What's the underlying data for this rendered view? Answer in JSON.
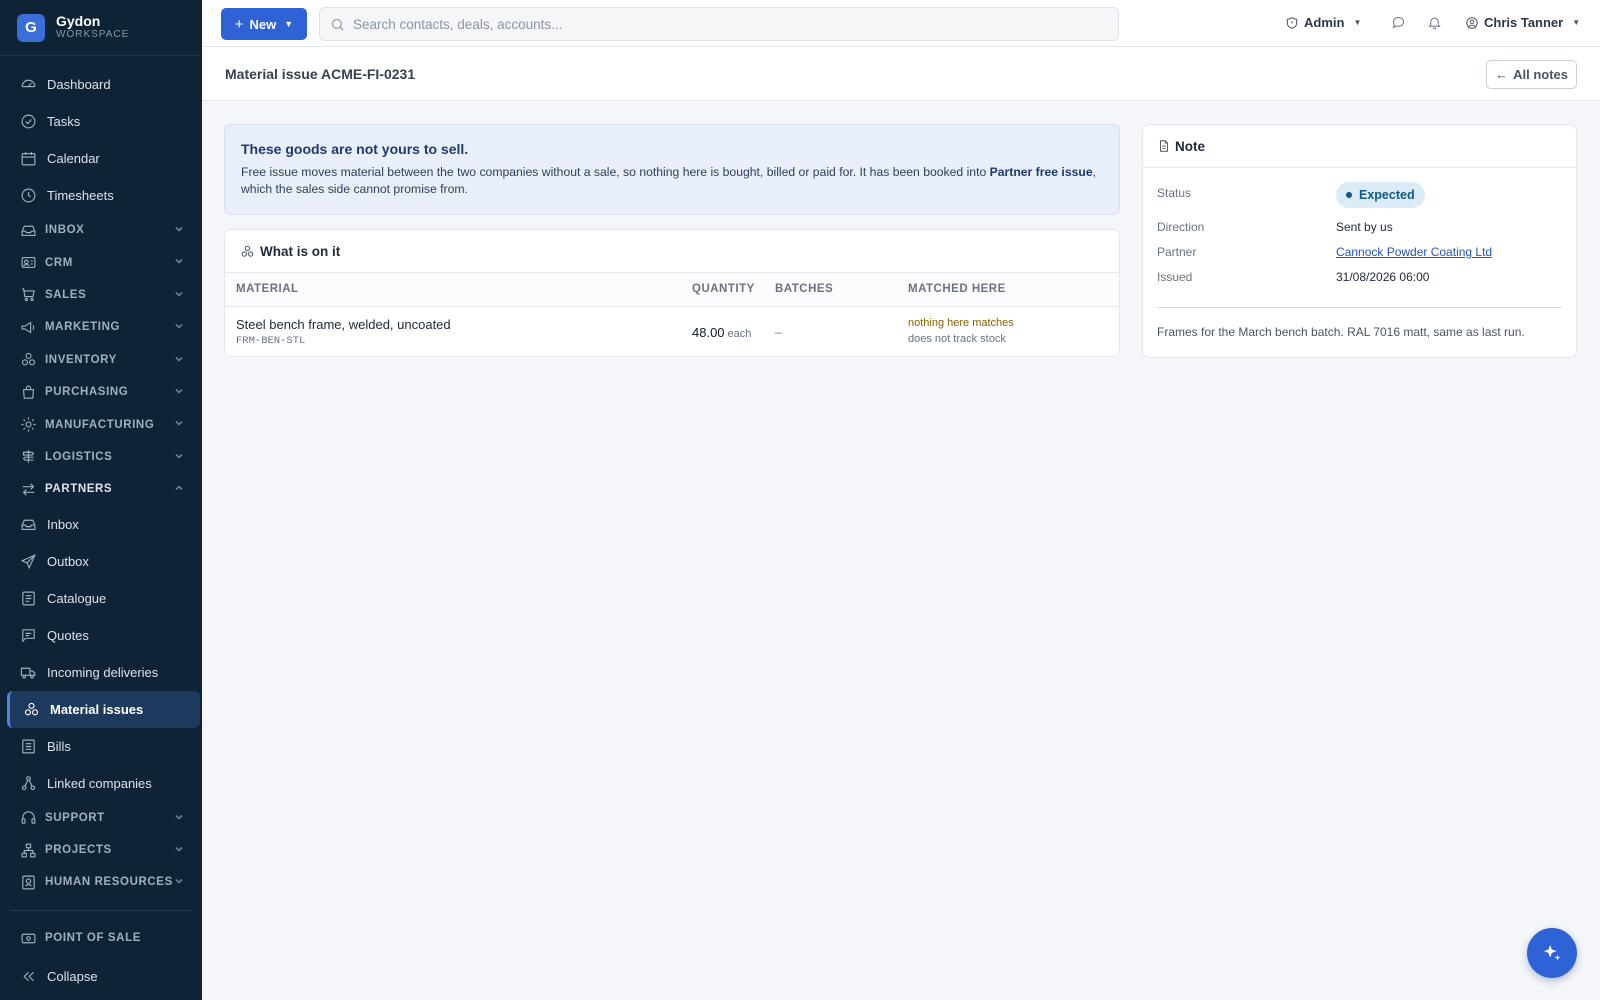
{
  "brand": {
    "name": "Gydon",
    "sub": "WORKSPACE",
    "logo_letter": "G"
  },
  "sidebar": {
    "items": [
      {
        "label": "Dashboard",
        "icon": "dashboard-icon"
      },
      {
        "label": "Tasks",
        "icon": "check-circle-icon"
      },
      {
        "label": "Calendar",
        "icon": "calendar-icon"
      },
      {
        "label": "Timesheets",
        "icon": "clock-icon"
      }
    ],
    "sections": [
      {
        "label": "INBOX",
        "icon": "inbox-icon"
      },
      {
        "label": "CRM",
        "icon": "contact-card-icon"
      },
      {
        "label": "SALES",
        "icon": "cart-icon"
      },
      {
        "label": "MARKETING",
        "icon": "megaphone-icon"
      },
      {
        "label": "INVENTORY",
        "icon": "boxes-icon"
      },
      {
        "label": "PURCHASING",
        "icon": "bag-icon"
      },
      {
        "label": "MANUFACTURING",
        "icon": "gear-icon"
      },
      {
        "label": "LOGISTICS",
        "icon": "signpost-icon"
      }
    ],
    "partners": {
      "label": "PARTNERS",
      "items": [
        {
          "label": "Inbox"
        },
        {
          "label": "Outbox"
        },
        {
          "label": "Catalogue"
        },
        {
          "label": "Quotes"
        },
        {
          "label": "Incoming deliveries"
        },
        {
          "label": "Material issues"
        },
        {
          "label": "Bills"
        },
        {
          "label": "Linked companies"
        }
      ]
    },
    "sections_after": [
      {
        "label": "SUPPORT"
      },
      {
        "label": "PROJECTS"
      },
      {
        "label": "HUMAN RESOURCES"
      }
    ],
    "pos": "POINT OF SALE",
    "collapse": "Collapse"
  },
  "topbar": {
    "new_label": "New",
    "search_placeholder": "Search contacts, deals, accounts...",
    "role": "Admin",
    "user": "Chris Tanner"
  },
  "page": {
    "title": "Material issue ACME-FI-0231",
    "all_notes": "All notes"
  },
  "alert": {
    "title": "These goods are not yours to sell.",
    "body_pre": "Free issue moves material between the two companies without a sale, so nothing here is bought, billed or paid for. It has been booked into ",
    "body_bold": "Partner free issue",
    "body_post": ", which the sales side cannot promise from."
  },
  "items_card": {
    "title": "What is on it",
    "columns": [
      "MATERIAL",
      "QUANTITY",
      "BATCHES",
      "MATCHED HERE"
    ],
    "rows": [
      {
        "name": "Steel bench frame, welded, uncoated",
        "code": "FRM-BEN-STL",
        "qty": "48.00",
        "unit": "each",
        "batches": "–",
        "match": "nothing here matches",
        "match_note": "does not track stock"
      }
    ]
  },
  "note": {
    "title": "Note",
    "status_label": "Status",
    "status": "Expected",
    "direction_label": "Direction",
    "direction": "Sent by us",
    "partner_label": "Partner",
    "partner": "Cannock Powder Coating Ltd",
    "issued_label": "Issued",
    "issued": "31/08/2026 06:00",
    "text": "Frames for the March bench batch. RAL 7016 matt, same as last run."
  },
  "colors": {
    "accent": "#2e62d6",
    "sidebar": "#0f2336",
    "status_badge": "#dcecf7"
  }
}
